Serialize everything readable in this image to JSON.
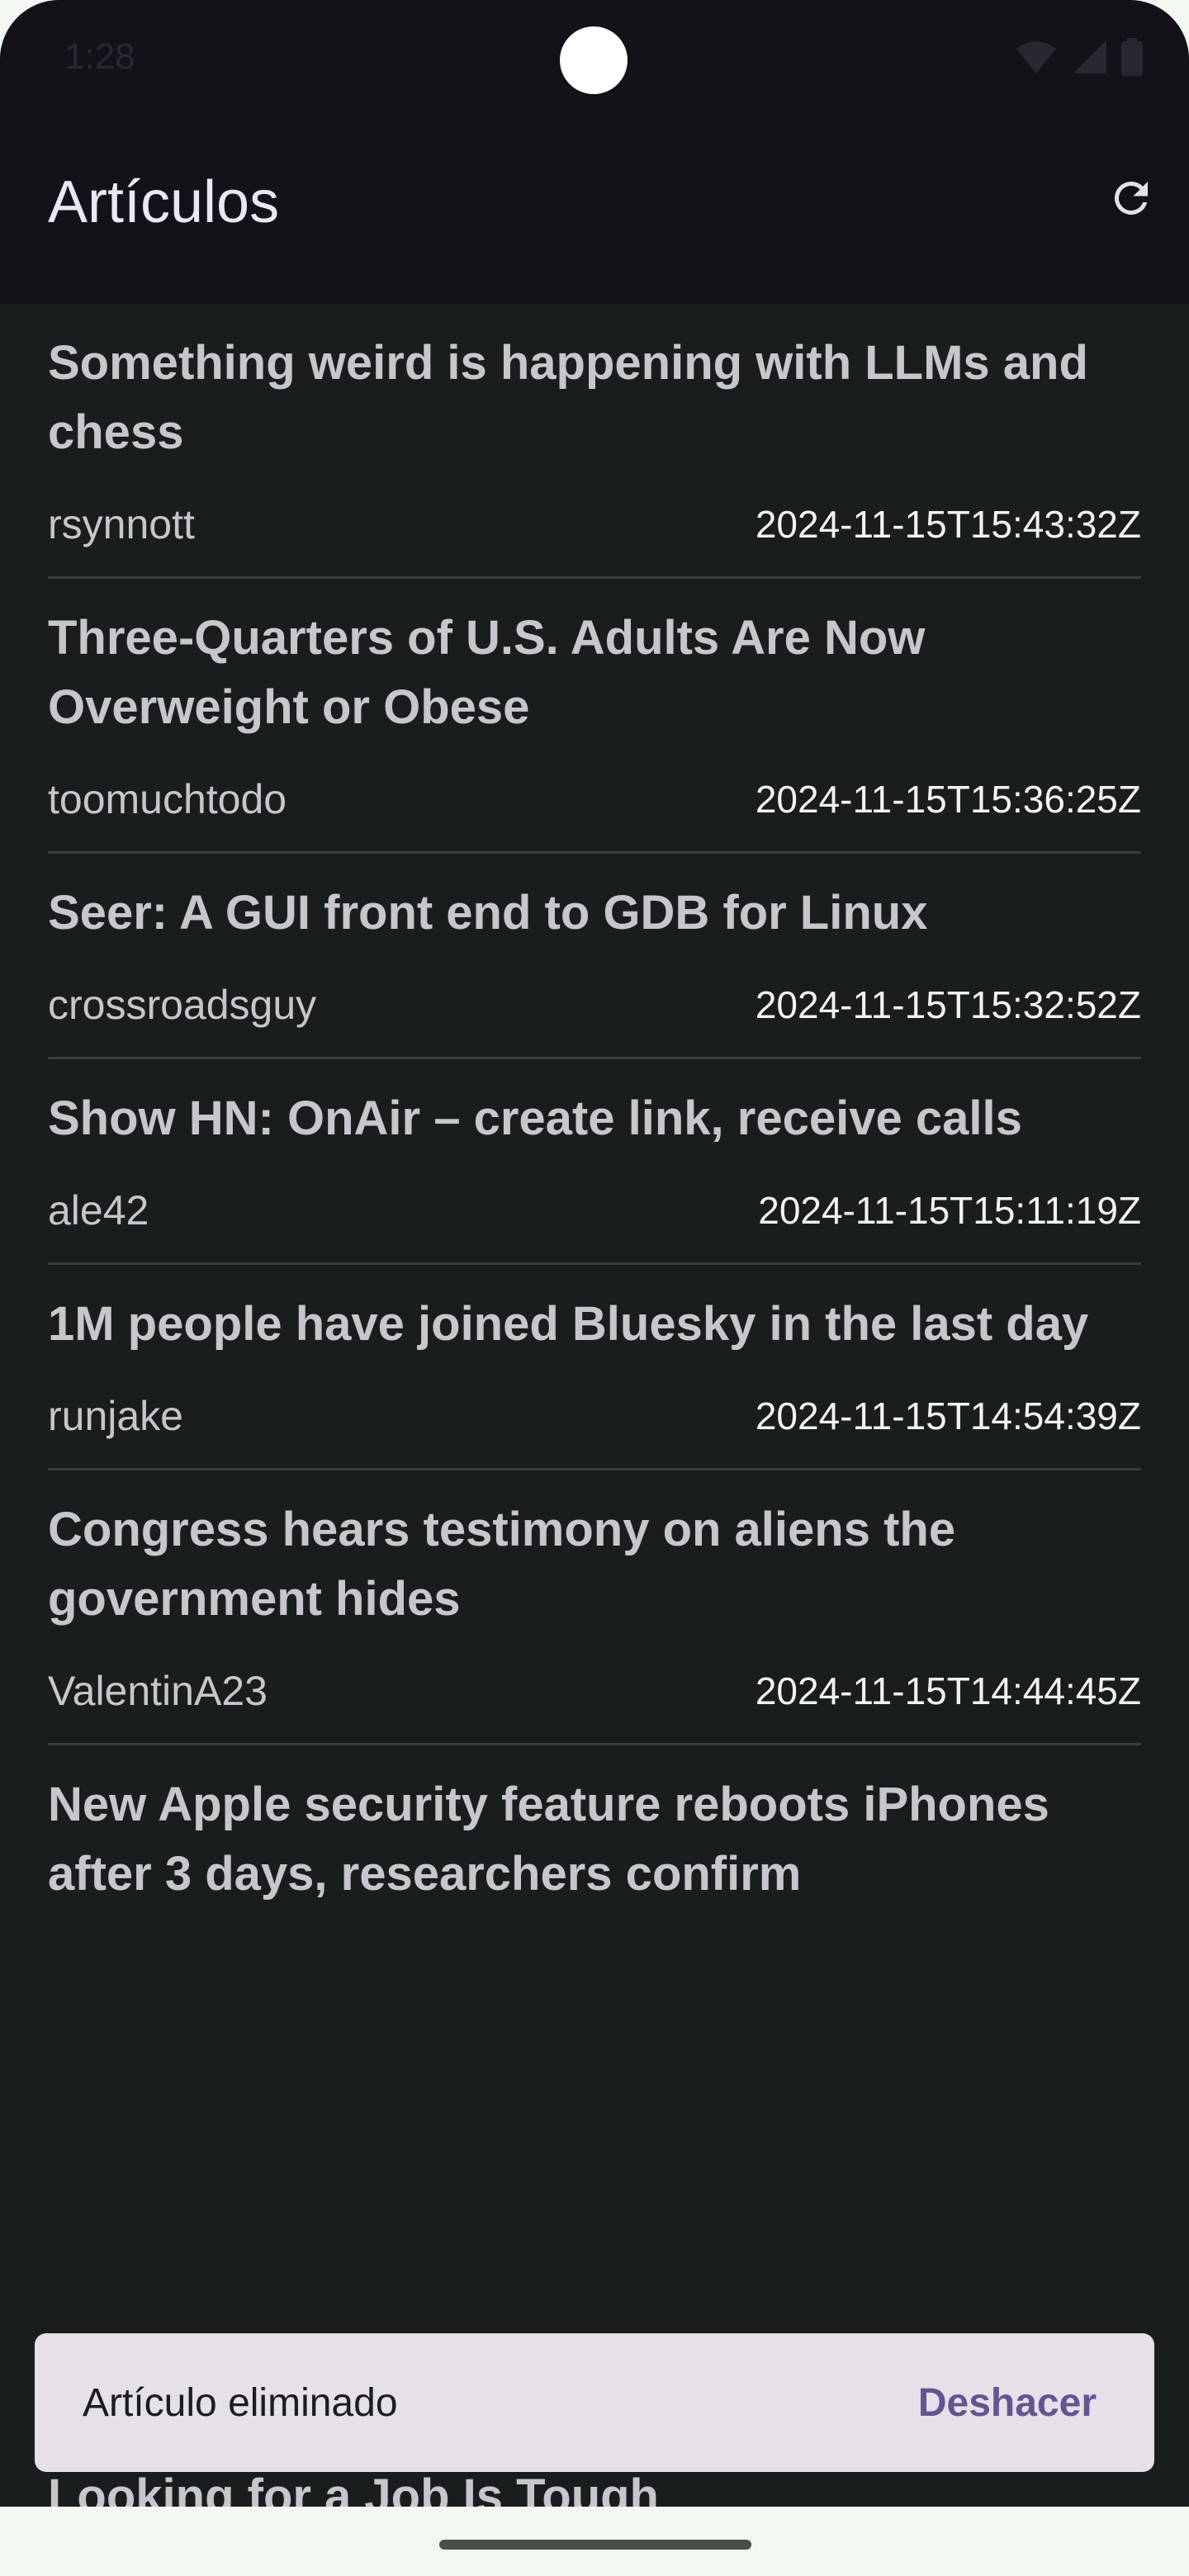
{
  "status_bar": {
    "time": "1:28"
  },
  "app_bar": {
    "title": "Artículos",
    "refresh_icon": "refresh-icon"
  },
  "articles": [
    {
      "title": "Something weird is happening with LLMs and chess",
      "author": "rsynnott",
      "date": "2024-11-15T15:43:32Z"
    },
    {
      "title": "Three-Quarters of U.S. Adults Are Now Overweight or Obese",
      "author": "toomuchtodo",
      "date": "2024-11-15T15:36:25Z"
    },
    {
      "title": "Seer: A GUI front end to GDB for Linux",
      "author": "crossroadsguy",
      "date": "2024-11-15T15:32:52Z"
    },
    {
      "title": "Show HN: OnAir – create link, receive calls",
      "author": "ale42",
      "date": "2024-11-15T15:11:19Z"
    },
    {
      "title": "1M people have joined Bluesky in the last day",
      "author": "runjake",
      "date": "2024-11-15T14:54:39Z"
    },
    {
      "title": "Congress hears testimony on aliens the government hides",
      "author": "ValentinA23",
      "date": "2024-11-15T14:44:45Z"
    },
    {
      "title": "New Apple security feature reboots iPhones after 3 days, researchers confirm"
    }
  ],
  "partial_article": {
    "title": "Looking for a Job Is Tough"
  },
  "snackbar": {
    "message": "Artículo eliminado",
    "action": "Deshacer"
  },
  "colors": {
    "app_bar_bg": "#141218",
    "list_bg": "#191d1d",
    "snackbar_bg": "#e6e0e9",
    "snackbar_action": "#65558f"
  }
}
